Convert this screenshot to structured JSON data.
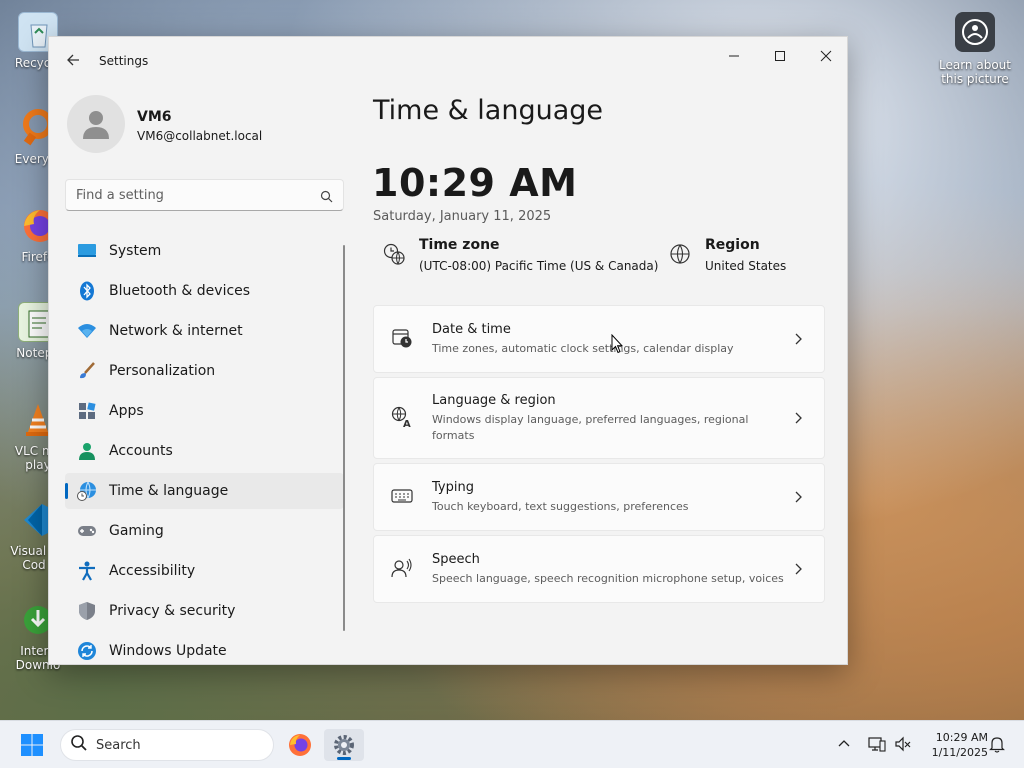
{
  "desktop": {
    "icons": [
      {
        "label": "Recycle"
      },
      {
        "label": "Everyth"
      },
      {
        "label": "Firefo"
      },
      {
        "label": "Notepa"
      },
      {
        "label": "VLC me play"
      },
      {
        "label": "Visual S Cod"
      },
      {
        "label": "Intern Downlo"
      }
    ],
    "learn_label": "Learn about this picture"
  },
  "window": {
    "app_title": "Settings",
    "controls": {
      "minimize": "minimize",
      "maximize": "maximize",
      "close": "close"
    }
  },
  "profile": {
    "name": "VM6",
    "email": "VM6@collabnet.local"
  },
  "search": {
    "placeholder": "Find a setting"
  },
  "sidebar": {
    "items": [
      {
        "label": "System",
        "icon": "monitor-icon",
        "color": "#0078d4"
      },
      {
        "label": "Bluetooth & devices",
        "icon": "bluetooth-icon",
        "color": "#0078d4"
      },
      {
        "label": "Network & internet",
        "icon": "wifi-icon",
        "color": "#0078d4"
      },
      {
        "label": "Personalization",
        "icon": "brush-icon",
        "color": "#c47a3a"
      },
      {
        "label": "Apps",
        "icon": "apps-icon",
        "color": "#5b6b82"
      },
      {
        "label": "Accounts",
        "icon": "accounts-icon",
        "color": "#1aa36b"
      },
      {
        "label": "Time & language",
        "icon": "globe-clock-icon",
        "color": "#0078d4"
      },
      {
        "label": "Gaming",
        "icon": "gamepad-icon",
        "color": "#6b7280"
      },
      {
        "label": "Accessibility",
        "icon": "accessibility-icon",
        "color": "#0067c0"
      },
      {
        "label": "Privacy & security",
        "icon": "shield-icon",
        "color": "#6b7280"
      },
      {
        "label": "Windows Update",
        "icon": "update-icon",
        "color": "#0078d4"
      }
    ],
    "active_index": 6
  },
  "main": {
    "title": "Time & language",
    "time": "10:29 AM",
    "date": "Saturday, January 11, 2025",
    "timezone": {
      "title": "Time zone",
      "value": "(UTC-08:00) Pacific Time (US & Canada)"
    },
    "region": {
      "title": "Region",
      "value": "United States"
    },
    "cards": [
      {
        "title": "Date & time",
        "subtitle": "Time zones, automatic clock settings, calendar display",
        "icon": "calendar-clock-icon"
      },
      {
        "title": "Language & region",
        "subtitle": "Windows display language, preferred languages, regional formats",
        "icon": "language-icon"
      },
      {
        "title": "Typing",
        "subtitle": "Touch keyboard, text suggestions, preferences",
        "icon": "keyboard-icon"
      },
      {
        "title": "Speech",
        "subtitle": "Speech language, speech recognition microphone setup, voices",
        "icon": "speech-icon"
      }
    ]
  },
  "taskbar": {
    "search_label": "Search",
    "clock_time": "10:29 AM",
    "clock_date": "1/11/2025"
  }
}
